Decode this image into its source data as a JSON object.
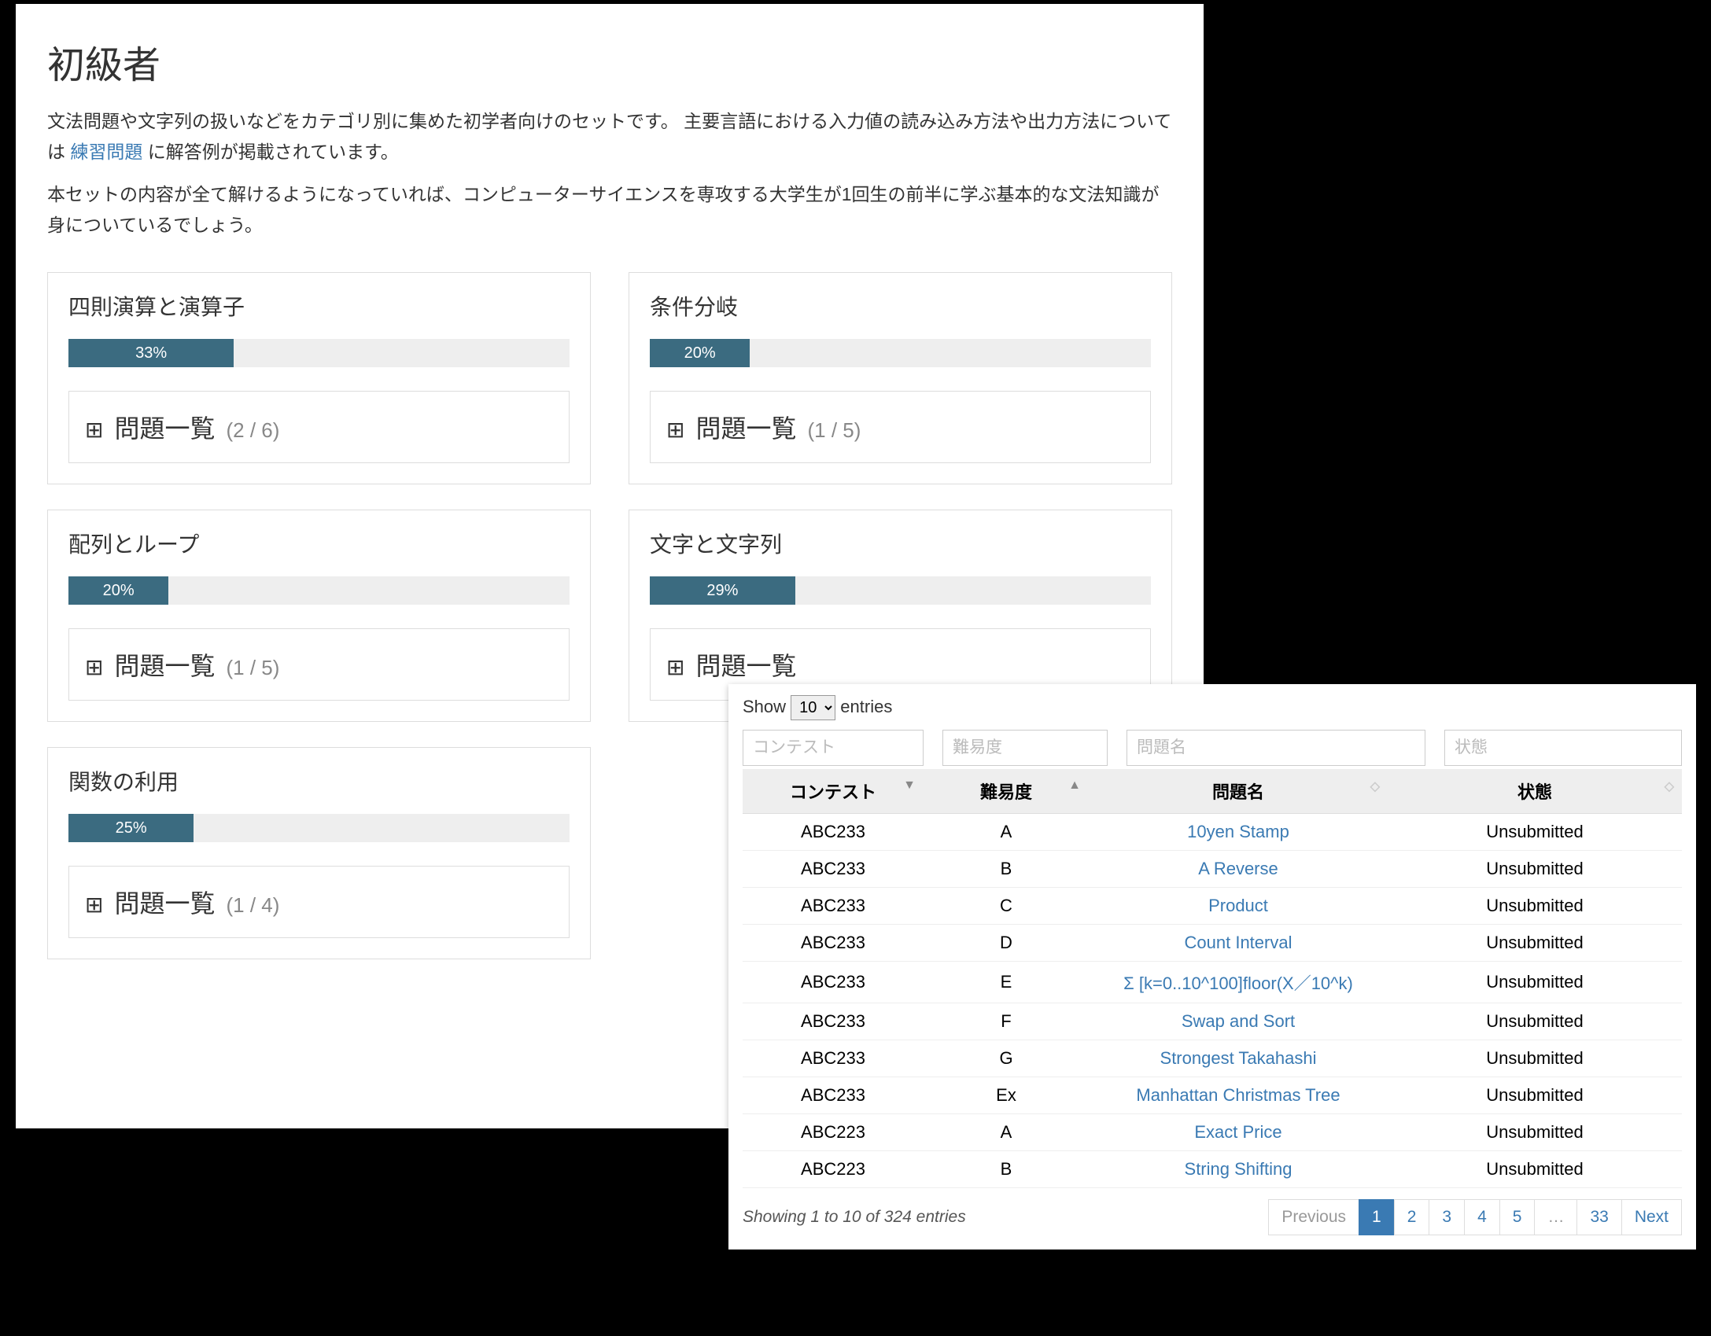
{
  "page": {
    "title": "初級者",
    "description1_pre": "文法問題や文字列の扱いなどをカテゴリ別に集めた初学者向けのセットです。 主要言語における入力値の読み込み方法や出力方法については ",
    "description1_link": "練習問題",
    "description1_post": " に解答例が掲載されています。",
    "description2": "本セットの内容が全て解けるようになっていれば、コンピューターサイエンスを専攻する大学生が1回生の前半に学ぶ基本的な文法知識が身についているでしょう。"
  },
  "cards": [
    {
      "title": "四則演算と演算子",
      "percent": 33,
      "percent_label": "33%",
      "list_label": "問題一覧",
      "count": "(2 / 6)"
    },
    {
      "title": "条件分岐",
      "percent": 20,
      "percent_label": "20%",
      "list_label": "問題一覧",
      "count": "(1 / 5)"
    },
    {
      "title": "配列とループ",
      "percent": 20,
      "percent_label": "20%",
      "list_label": "問題一覧",
      "count": "(1 / 5)"
    },
    {
      "title": "文字と文字列",
      "percent": 29,
      "percent_label": "29%",
      "list_label": "問題一覧",
      "count": ""
    },
    {
      "title": "関数の利用",
      "percent": 25,
      "percent_label": "25%",
      "list_label": "問題一覧",
      "count": "(1 / 4)"
    }
  ],
  "table": {
    "length_prefix": "Show",
    "length_value": "10",
    "length_suffix": "entries",
    "filters": {
      "contest": "コンテスト",
      "difficulty": "難易度",
      "problem": "問題名",
      "status": "状態"
    },
    "headers": {
      "contest": "コンテスト",
      "difficulty": "難易度",
      "problem": "問題名",
      "status": "状態"
    },
    "rows": [
      {
        "contest": "ABC233",
        "diff": "A",
        "name": "10yen Stamp",
        "status": "Unsubmitted"
      },
      {
        "contest": "ABC233",
        "diff": "B",
        "name": "A Reverse",
        "status": "Unsubmitted"
      },
      {
        "contest": "ABC233",
        "diff": "C",
        "name": "Product",
        "status": "Unsubmitted"
      },
      {
        "contest": "ABC233",
        "diff": "D",
        "name": "Count Interval",
        "status": "Unsubmitted"
      },
      {
        "contest": "ABC233",
        "diff": "E",
        "name": "Σ [k=0..10^100]floor(X／10^k)",
        "status": "Unsubmitted"
      },
      {
        "contest": "ABC233",
        "diff": "F",
        "name": "Swap and Sort",
        "status": "Unsubmitted"
      },
      {
        "contest": "ABC233",
        "diff": "G",
        "name": "Strongest Takahashi",
        "status": "Unsubmitted"
      },
      {
        "contest": "ABC233",
        "diff": "Ex",
        "name": "Manhattan Christmas Tree",
        "status": "Unsubmitted"
      },
      {
        "contest": "ABC223",
        "diff": "A",
        "name": "Exact Price",
        "status": "Unsubmitted"
      },
      {
        "contest": "ABC223",
        "diff": "B",
        "name": "String Shifting",
        "status": "Unsubmitted"
      }
    ],
    "info": "Showing 1 to 10 of 324 entries",
    "pager": {
      "prev": "Previous",
      "pages": [
        "1",
        "2",
        "3",
        "4",
        "5",
        "…",
        "33"
      ],
      "next": "Next",
      "active": "1"
    }
  }
}
